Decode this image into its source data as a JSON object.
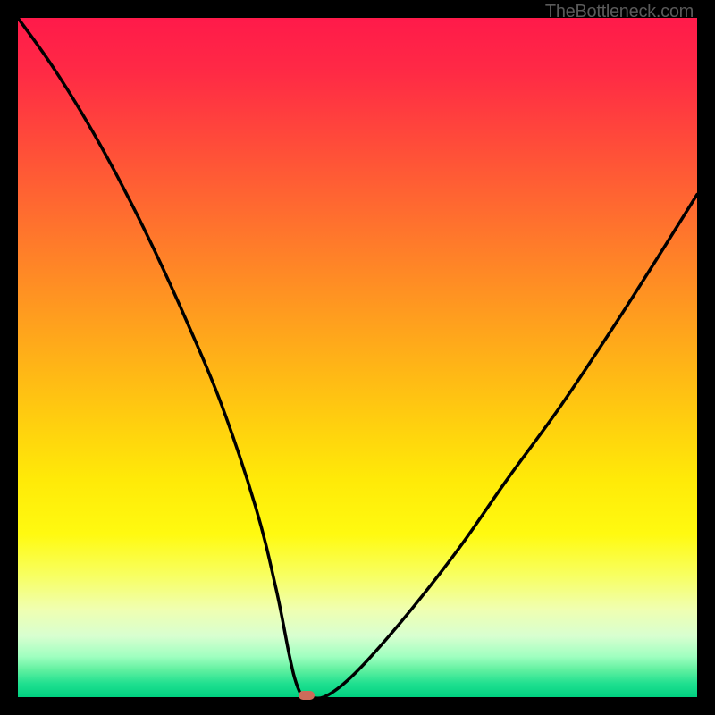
{
  "watermark": "TheBottleneck.com",
  "chart_data": {
    "type": "line",
    "title": "",
    "xlabel": "",
    "ylabel": "",
    "xlim": [
      0,
      100
    ],
    "ylim": [
      0,
      100
    ],
    "x": [
      0,
      5,
      10,
      15,
      20,
      25,
      30,
      35,
      38,
      40,
      41,
      42,
      43,
      45,
      48,
      52,
      58,
      65,
      72,
      80,
      88,
      95,
      100
    ],
    "values": [
      100,
      93,
      85,
      76,
      66,
      55,
      43,
      28,
      16,
      6,
      2,
      0,
      0,
      0,
      2,
      6,
      13,
      22,
      32,
      43,
      55,
      66,
      74
    ],
    "marker": {
      "x": 42.5,
      "y": 0
    },
    "background_gradient": {
      "top_color": "#ff1a4a",
      "mid_color": "#ffea08",
      "bottom_color": "#00d080"
    }
  }
}
